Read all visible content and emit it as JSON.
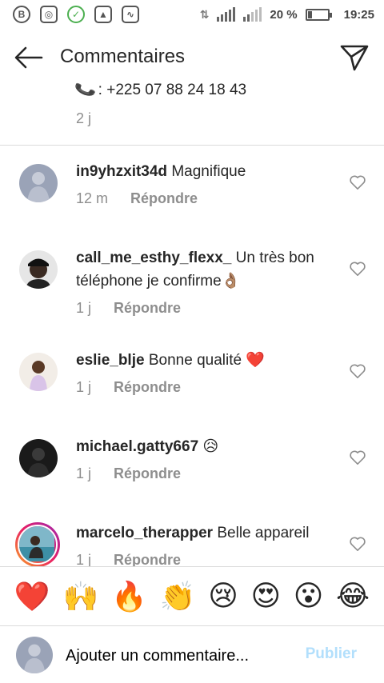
{
  "status_bar": {
    "battery": "20 %",
    "time": "19:25",
    "battery_level": 0.2
  },
  "header": {
    "title": "Commentaires"
  },
  "post": {
    "snippet": ": +225 07 88 24 18 43",
    "time": "2 j"
  },
  "comments": [
    {
      "username": "in9yhzxit34d",
      "text": "Magnifique",
      "time": "12 m",
      "reply_label": "Répondre"
    },
    {
      "username": "call_me_esthy_flexx_",
      "text": "Un très bon téléphone je confirme👌🏽",
      "time": "1 j",
      "reply_label": "Répondre"
    },
    {
      "username": "eslie_blje",
      "text": "Bonne qualité ❤️",
      "time": "1 j",
      "reply_label": "Répondre"
    },
    {
      "username": "michael.gatty667",
      "text": "😥",
      "time": "1 j",
      "reply_label": "Répondre"
    },
    {
      "username": "marcelo_therapper",
      "text": "Belle appareil",
      "time": "1 j",
      "reply_label": "Répondre"
    }
  ],
  "emoji_bar": [
    "❤️",
    "🙌",
    "🔥",
    "👏",
    "😢",
    "😍",
    "😮",
    "😂"
  ],
  "input": {
    "placeholder": "Ajouter un commentaire...",
    "publish_label": "Publier"
  },
  "colors": {
    "accent_disabled": "#b2dffc",
    "secondary_text": "#8e8e8e",
    "heart_red": "#ed4956"
  }
}
